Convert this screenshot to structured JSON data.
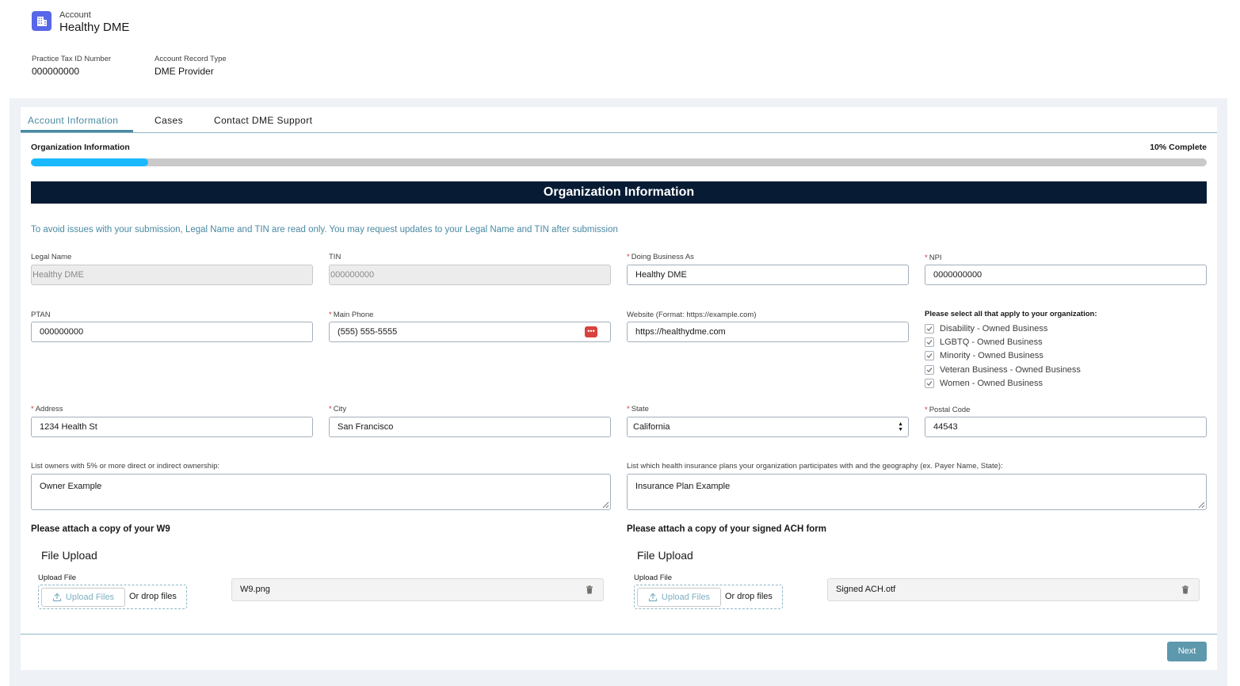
{
  "header": {
    "object_type": "Account",
    "account_name": "Healthy DME",
    "fields": [
      {
        "label": "Practice Tax ID Number",
        "value": "000000000"
      },
      {
        "label": "Account Record Type",
        "value": "DME Provider"
      }
    ]
  },
  "tabs": [
    {
      "label": "Account Information",
      "active": true
    },
    {
      "label": "Cases",
      "active": false
    },
    {
      "label": "Contact DME Support",
      "active": false
    }
  ],
  "progress": {
    "step_title": "Organization Information",
    "percent_label": "10% Complete",
    "percent": 10,
    "fill_color": "#1ab9ff"
  },
  "section": {
    "title": "Organization Information",
    "notice": "To avoid issues with your submission, Legal Name and TIN are read only. You may request updates to your Legal Name and TIN after submission"
  },
  "fields": {
    "legal_name": {
      "label": "Legal Name",
      "value": "Healthy DME"
    },
    "tin": {
      "label": "TIN",
      "value": "000000000"
    },
    "dba": {
      "label": "Doing Business As",
      "value": "Healthy DME",
      "required": "*"
    },
    "npi": {
      "label": "NPI",
      "value": "0000000000",
      "required": "*"
    },
    "ptan": {
      "label": "PTAN",
      "value": "000000000"
    },
    "main_phone": {
      "label": "Main Phone",
      "value": "(555) 555-5555",
      "required": "*"
    },
    "website": {
      "label": "Website (Format: https://example.com)",
      "value": "https://healthydme.com"
    },
    "address": {
      "label": "Address",
      "value": "1234 Health St",
      "required": "*"
    },
    "city": {
      "label": "City",
      "value": "San Francisco",
      "required": "*"
    },
    "state": {
      "label": "State",
      "value": "California",
      "required": "*"
    },
    "postal_code": {
      "label": "Postal Code",
      "value": "44543",
      "required": "*"
    },
    "owners": {
      "label": "List owners with 5% or more direct or indirect ownership:",
      "value": "Owner Example"
    },
    "insurance": {
      "label": "List which health insurance plans your organization participates with and the geography (ex. Payer Name, State):",
      "value": "Insurance Plan Example"
    }
  },
  "business_types": {
    "title": "Please select all that apply to your organization:",
    "options": [
      {
        "label": "Disability - Owned Business",
        "checked": true
      },
      {
        "label": "LGBTQ - Owned Business",
        "checked": true
      },
      {
        "label": "Minority - Owned Business",
        "checked": true
      },
      {
        "label": "Veteran Business - Owned Business",
        "checked": true
      },
      {
        "label": "Women - Owned Business",
        "checked": true
      }
    ]
  },
  "attachments": {
    "w9": {
      "title": "Please attach a copy of your W9",
      "upload_title": "File Upload",
      "upload_label": "Upload File",
      "button": "Upload Files",
      "drop_text": "Or drop files",
      "file_name": "W9.png"
    },
    "ach": {
      "title": "Please attach a copy of your signed ACH form",
      "upload_title": "File Upload",
      "upload_label": "Upload File",
      "button": "Upload Files",
      "drop_text": "Or drop files",
      "file_name": "Signed ACH.otf"
    }
  },
  "footer": {
    "next_label": "Next"
  },
  "colors": {
    "accent": "#4a8aa2",
    "banner": "#071b35",
    "required": "#c23934",
    "icon_bg": "#5867e8"
  },
  "icons": {
    "account": "building-icon",
    "phone_autofill": "dots-badge-icon",
    "upload": "upload-icon",
    "delete": "trash-icon",
    "checkbox": "check-icon"
  }
}
